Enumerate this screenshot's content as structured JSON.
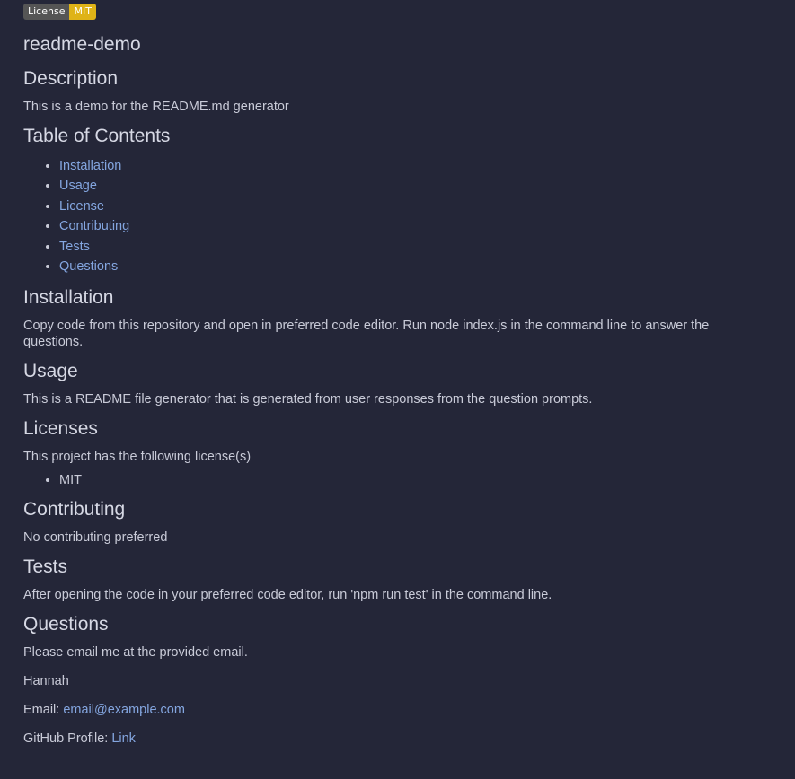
{
  "badge": {
    "left": "License",
    "right": "MIT"
  },
  "title": "readme-demo",
  "description": {
    "heading": "Description",
    "text": "This is a demo for the README.md generator"
  },
  "toc": {
    "heading": "Table of Contents",
    "items": [
      "Installation",
      "Usage",
      "License",
      "Contributing",
      "Tests",
      "Questions"
    ]
  },
  "installation": {
    "heading": "Installation",
    "text": "Copy code from this repository and open in preferred code editor. Run node index.js in the command line to answer the questions."
  },
  "usage": {
    "heading": "Usage",
    "text": "This is a README file generator that is generated from user responses from the question prompts."
  },
  "licenses": {
    "heading": "Licenses",
    "text": "This project has the following license(s)",
    "items": [
      "MIT"
    ]
  },
  "contributing": {
    "heading": "Contributing",
    "text": "No contributing preferred"
  },
  "tests": {
    "heading": "Tests",
    "text": "After opening the code in your preferred code editor, run 'npm run test' in the command line."
  },
  "questions": {
    "heading": "Questions",
    "text": "Please email me at the provided email.",
    "name": "Hannah",
    "email_label": "Email: ",
    "email": "email@example.com",
    "github_label": "GitHub Profile: ",
    "github_link": "Link"
  },
  "colors": {
    "background": "#242638",
    "text": "#c9cbd8",
    "link": "#84a6e0",
    "badge_left": "#555555",
    "badge_right": "#dfb317"
  }
}
